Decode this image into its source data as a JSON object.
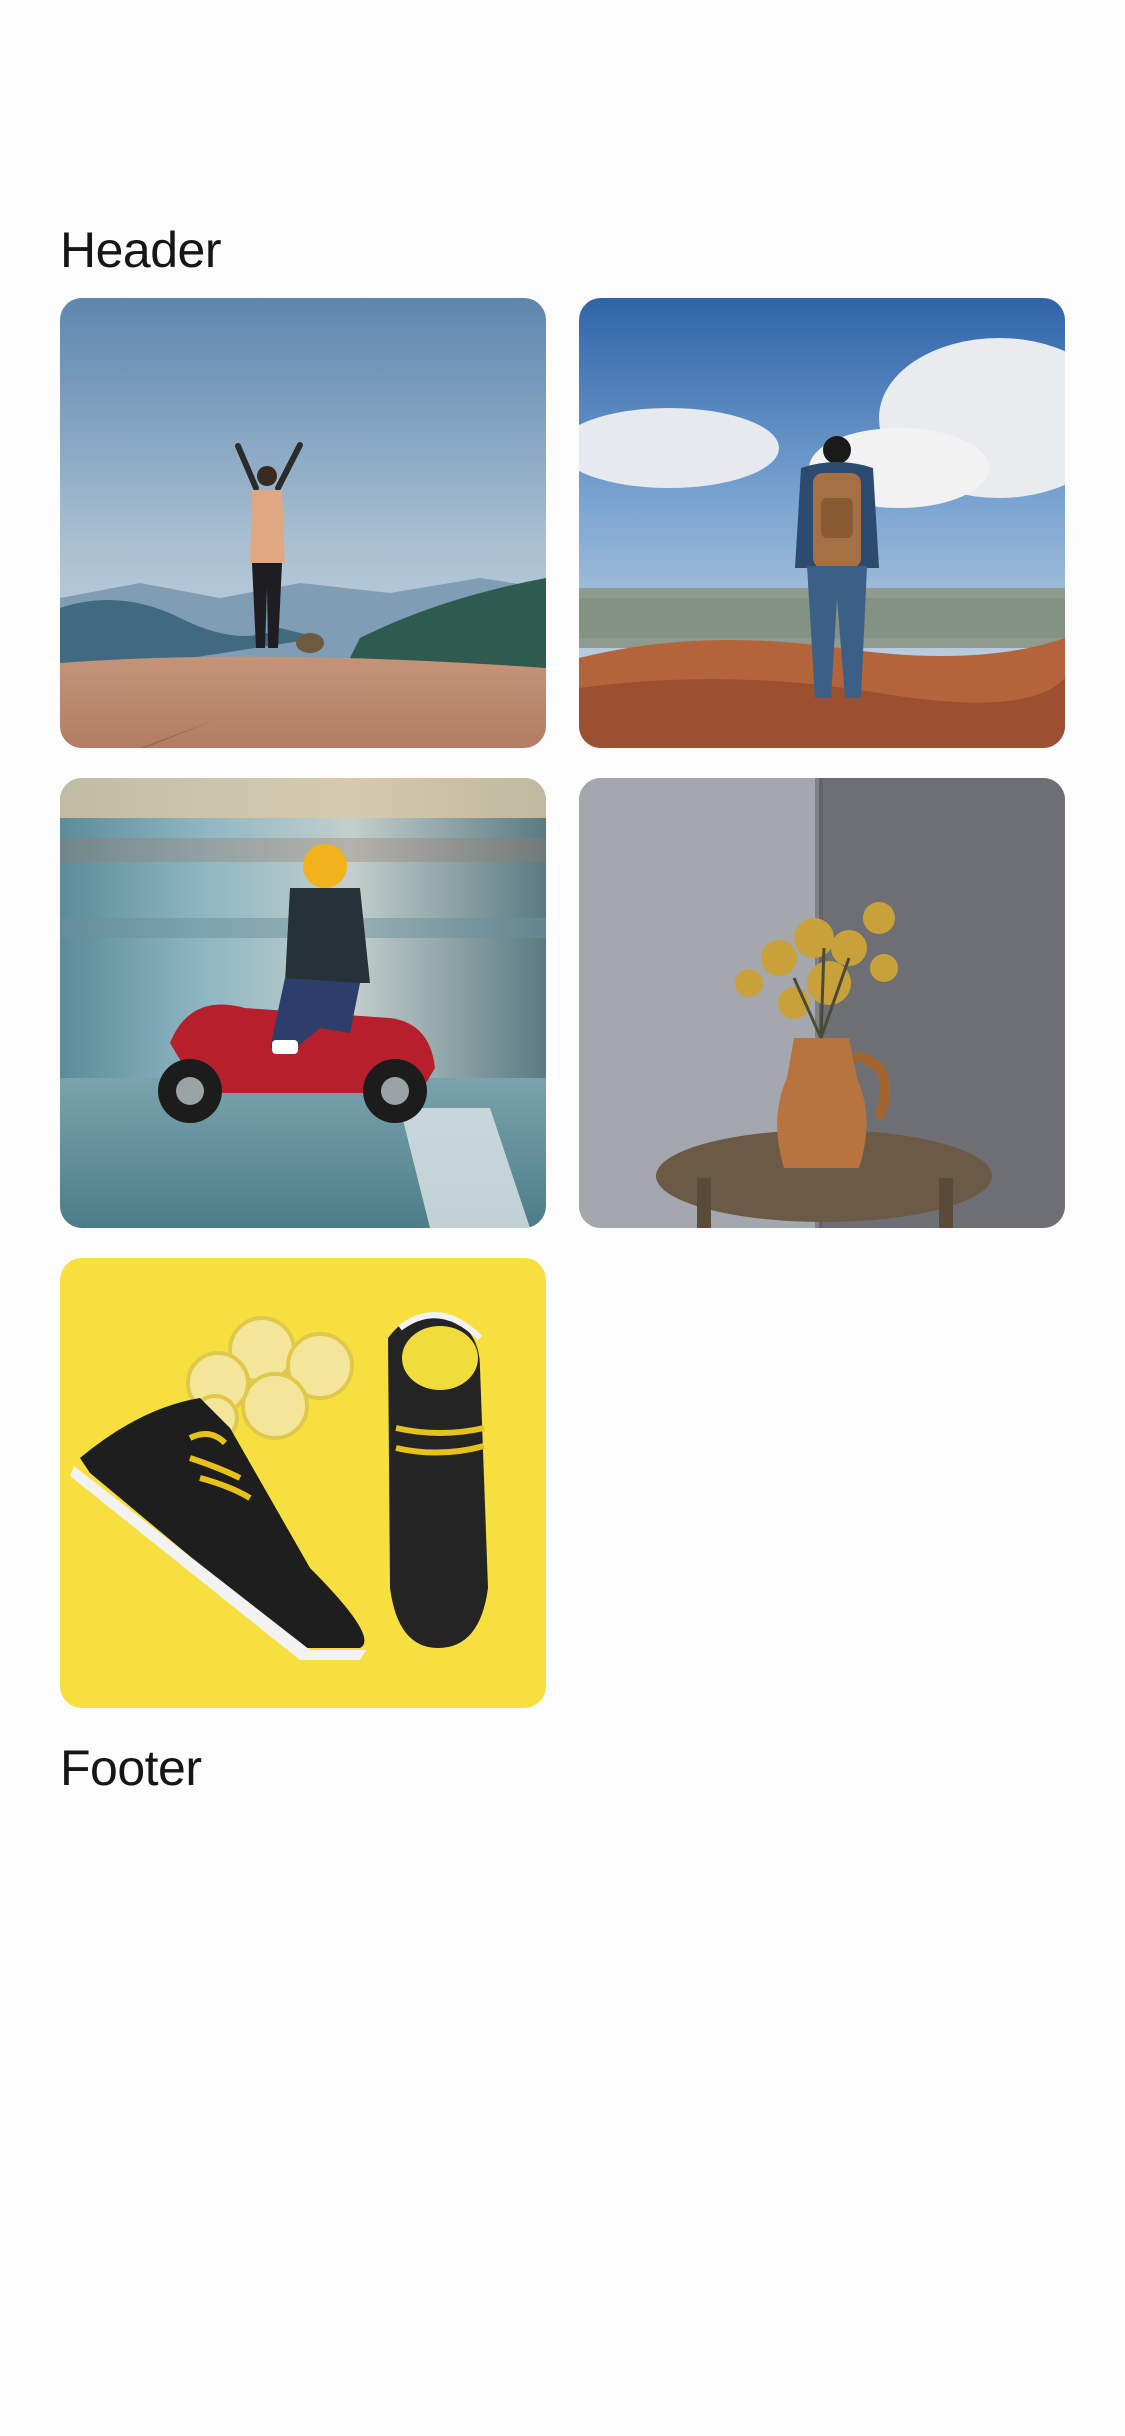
{
  "header": {
    "title": "Header"
  },
  "footer": {
    "title": "Footer"
  },
  "gallery": {
    "photos": [
      {
        "subject": "hiker-arms-raised-on-cliff"
      },
      {
        "subject": "hiker-with-backpack-overlooking-valley"
      },
      {
        "subject": "rider-on-red-scooter"
      },
      {
        "subject": "dried-flowers-in-clay-jug"
      },
      {
        "subject": "black-sneakers-with-lemons"
      }
    ]
  }
}
